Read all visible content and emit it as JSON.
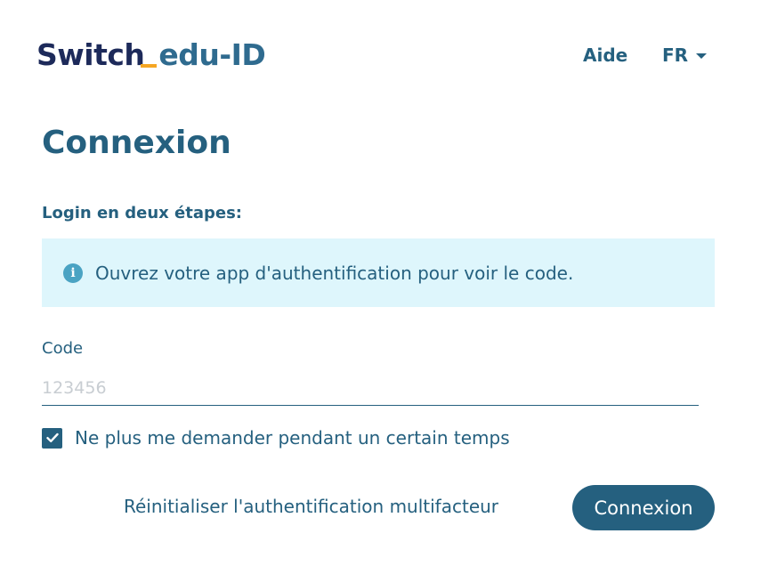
{
  "header": {
    "logo_switch": "Switch",
    "logo_eduid": "edu-ID",
    "help_label": "Aide",
    "language_label": "FR"
  },
  "main": {
    "title": "Connexion",
    "subtitle": "Login en deux étapes:",
    "info_message": "Ouvrez votre app d'authentification pour voir le code.",
    "code_label": "Code",
    "code_value": "",
    "code_placeholder": "123456",
    "remember_label": "Ne plus me demander pendant un certain temps",
    "remember_checked": true,
    "reset_link_label": "Réinitialiser l'authentification multifacteur",
    "submit_label": "Connexion"
  },
  "colors": {
    "primary": "#25607f",
    "logo_dark": "#1d2a5a",
    "logo_accent": "#f5a623",
    "info_background": "#def6fc",
    "info_icon": "#4aa3c3"
  },
  "icons": {
    "info": "info-circle-icon",
    "checkbox": "checkmark-icon",
    "language_caret": "chevron-down-icon"
  }
}
